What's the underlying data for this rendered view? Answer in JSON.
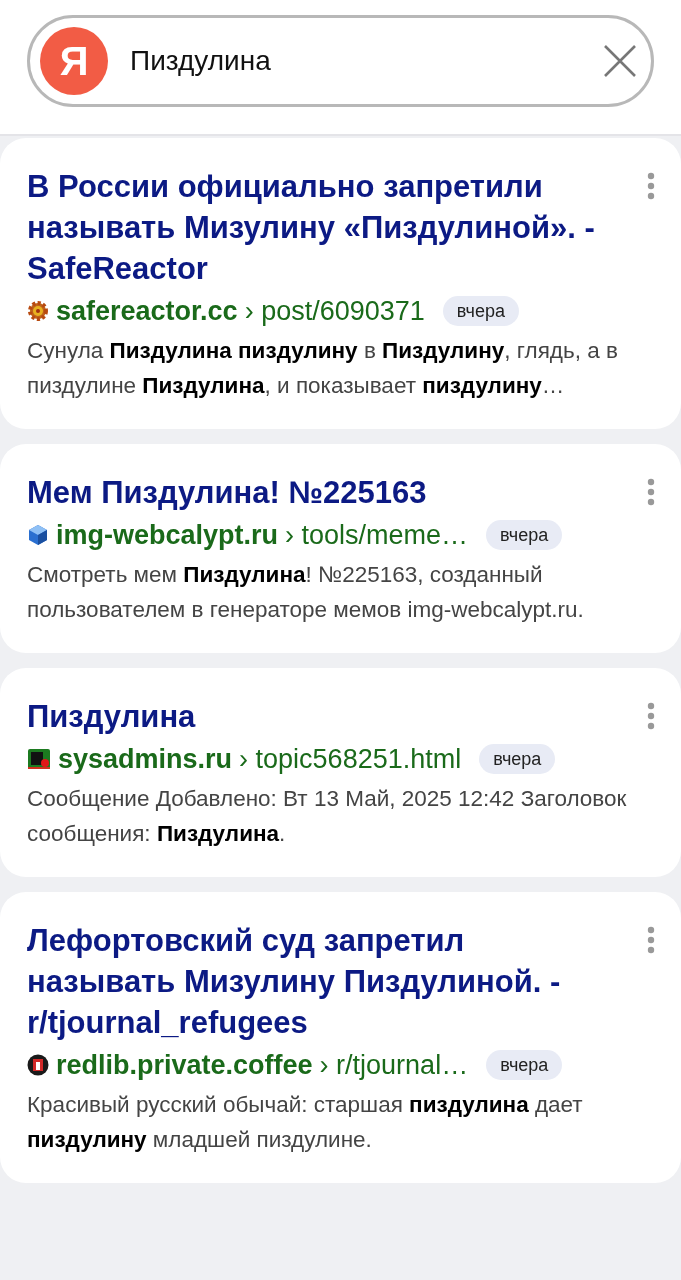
{
  "search": {
    "logo": "Я",
    "query": "Пиздулина"
  },
  "results": [
    {
      "title": "В России официально запретили называть Мизулину «Пиздулиной». - SafeReactor",
      "kind": "reactor",
      "domain": "safereactor.cc",
      "path": "› post/6090371",
      "date": "вчера",
      "snippet": "Сунула **Пиздулина пиздулину** в **Пиздулину**, глядь, а в пиздулине **Пиздулина**, и показывает **пиздулину**…"
    },
    {
      "title": "Мем Пиздулина! №225163",
      "kind": "cube",
      "domain": "img-webcalypt.ru",
      "path": "› tools/meme…",
      "date": "вчера",
      "snippet": "Смотреть мем **Пиздулина**! №225163, созданный пользователем в генераторе мемов img-webcalypt.ru."
    },
    {
      "title": "Пиздулина",
      "kind": "square",
      "domain": "sysadmins.ru",
      "path": "› topic568251.html",
      "date": "вчера",
      "snippet": "Сообщение Добавлено: Вт 13 Май, 2025 12:42 Заголовок сообщения: **Пиздулина**."
    },
    {
      "title": "Лефортовский суд запретил называть Мизулину Пиздулиной. - r/tjournal_refugees",
      "kind": "circle",
      "domain": "redlib.private.coffee",
      "path": "› r/tjournal…",
      "date": "вчера",
      "snippet": "Красивый русский обычай: старшая **пиздулина** дает **пиздулину** младшей пиздулине."
    }
  ]
}
